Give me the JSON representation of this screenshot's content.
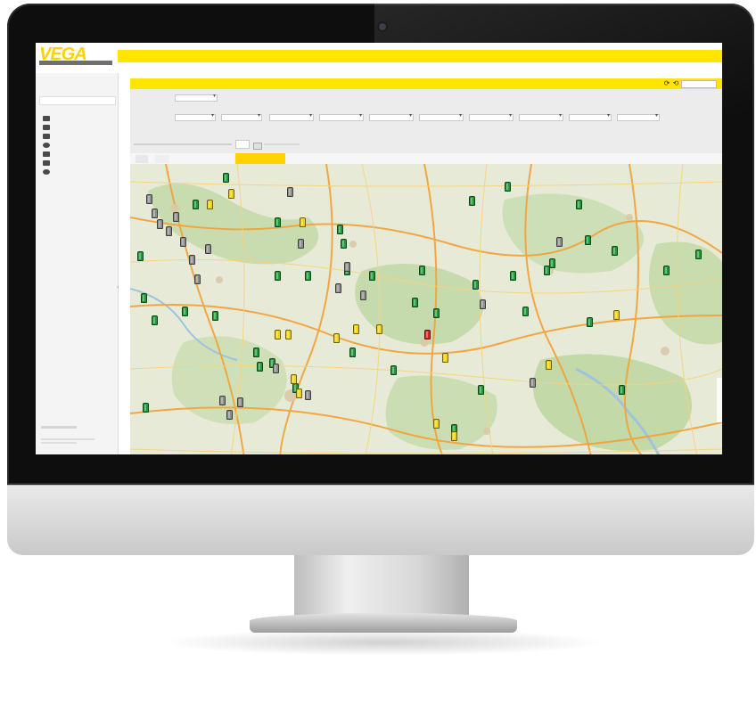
{
  "app": {
    "logo_text": "VEGA",
    "brand_color": "#ffe500",
    "accent_color": "#ffd200"
  },
  "sidebar": {
    "icons": [
      "dashboard-icon",
      "folder-icon",
      "chart-icon",
      "settings-icon",
      "list-icon",
      "calendar-icon",
      "info-icon"
    ]
  },
  "toolbar": {
    "icons": [
      "refresh-icon",
      "settings-icon",
      "dropdown-icon"
    ]
  },
  "markers": {
    "status_colors": {
      "ok": "#1f9c3a",
      "warning": "#f0d400",
      "inactive": "#8d8d8d",
      "alarm": "#d7261c"
    },
    "counts_by_status": {
      "ok": 40,
      "warning": 15,
      "inactive": 22,
      "alarm": 1
    }
  }
}
